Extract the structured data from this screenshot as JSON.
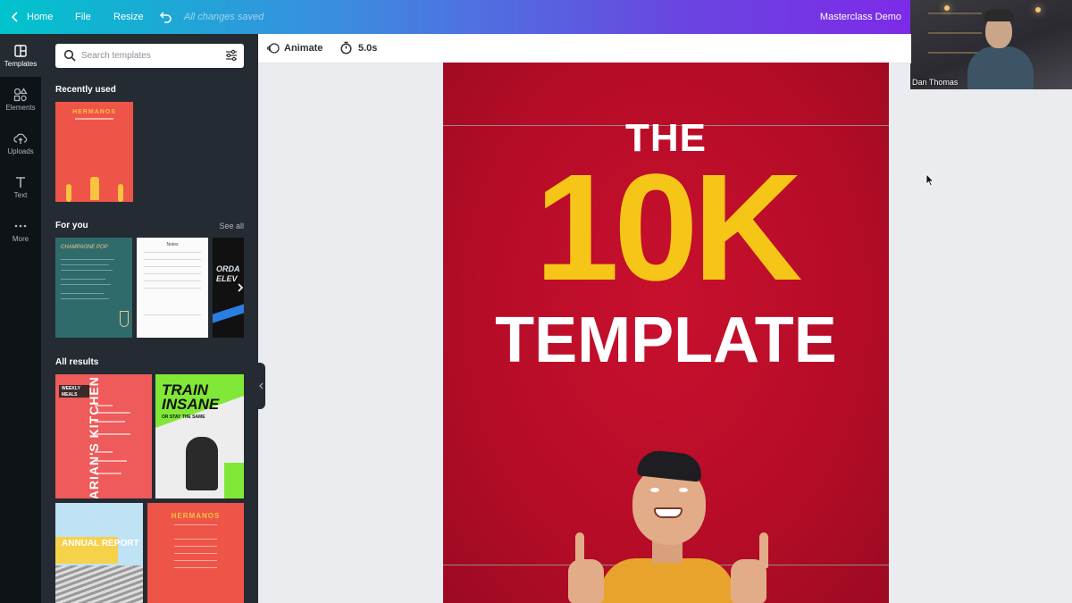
{
  "topbar": {
    "home_label": "Home",
    "file_label": "File",
    "resize_label": "Resize",
    "save_status": "All changes saved",
    "design_title": "Masterclass Demo"
  },
  "webcam": {
    "participant_name": "Dan Thomas"
  },
  "rail": {
    "items": [
      {
        "label": "Templates",
        "icon": "templates-icon"
      },
      {
        "label": "Elements",
        "icon": "elements-icon"
      },
      {
        "label": "Uploads",
        "icon": "upload-cloud-icon"
      },
      {
        "label": "Text",
        "icon": "text-icon"
      },
      {
        "label": "More",
        "icon": "more-dots-icon"
      }
    ]
  },
  "panel": {
    "search_placeholder": "Search templates",
    "recently_used_title": "Recently used",
    "for_you_title": "For you",
    "see_all_label": "See all",
    "all_results_title": "All results",
    "thumbs": {
      "recent_1_title": "HERMANOS",
      "foryou_1_title": "CHAMPAGNE POP",
      "foryou_2_title": "Notes",
      "foryou_3_title": "ORDA ELEV",
      "result_1_badge": "WEEKLY MEALS",
      "result_1_title": "MARIAN'S KITCHEN",
      "result_2_title": "TRAIN INSANE",
      "result_2_sub": "OR STAY THE SAME",
      "result_3_title": "ANNUAL REPORT",
      "result_4_title": "HERMANOS"
    }
  },
  "toolbar": {
    "animate_label": "Animate",
    "duration_label": "5.0s"
  },
  "canvas": {
    "line1": "THE",
    "line2": "10K",
    "line3": "TEMPLATE",
    "background_color": "#c8102e",
    "accent_color": "#f5c518"
  },
  "colors": {
    "gradient_start": "#00c4cc",
    "gradient_end": "#7d2ae8",
    "sidebar_dark": "#0e1318",
    "panel_dark": "#252b33"
  }
}
